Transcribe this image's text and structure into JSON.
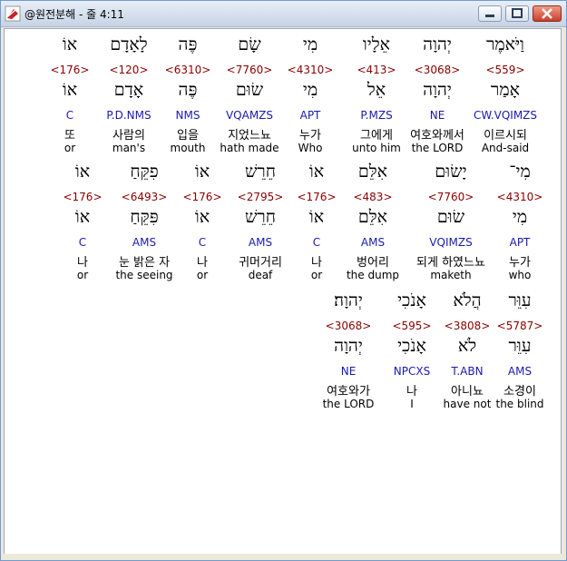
{
  "window": {
    "title": "@원전분해 - 줄 4:11"
  },
  "colors": {
    "strong": "#8b0000",
    "parse": "#1a1ab0",
    "text": "#000000"
  },
  "rows": [
    [
      {
        "heb": "וַיֹּאמֶר",
        "num": "<559>",
        "lemma": "אָמַר",
        "parse": "CW.VQIMZS",
        "kor": "이르시되",
        "eng": "And-said"
      },
      {
        "heb": "יְהוָה",
        "num": "<3068>",
        "lemma": "יְהוָה",
        "parse": "NE",
        "kor": "여호와께서",
        "eng": "the LORD"
      },
      {
        "heb": "אֵלָיו",
        "num": "<413>",
        "lemma": "אֵל",
        "parse": "P.MZS",
        "kor": "그에게",
        "eng": "unto him"
      },
      {
        "heb": "מִי",
        "num": "<4310>",
        "lemma": "מִי",
        "parse": "APT",
        "kor": "누가",
        "eng": "Who"
      },
      {
        "heb": "שָׂם",
        "num": "<7760>",
        "lemma": "שׂוּם",
        "parse": "VQAMZS",
        "kor": "지었느뇨",
        "eng": "hath made"
      },
      {
        "heb": "פֶּה",
        "num": "<6310>",
        "lemma": "פֶּה",
        "parse": "NMS",
        "kor": "입을",
        "eng": "mouth"
      },
      {
        "heb": "לָאָדָם",
        "num": "<120>",
        "lemma": "אָדָם",
        "parse": "P.D.NMS",
        "kor": "사람의",
        "eng": "man's"
      },
      {
        "heb": "אוֹ",
        "num": "<176>",
        "lemma": "אוֹ",
        "parse": "C",
        "kor": "또",
        "eng": "or"
      }
    ],
    [
      {
        "heb": "מִי־",
        "num": "<4310>",
        "lemma": "מִי",
        "parse": "APT",
        "kor": "누가",
        "eng": "who"
      },
      {
        "heb": "יָשׂוּם",
        "num": "<7760>",
        "lemma": "שׂוּם",
        "parse": "VQIMZS",
        "kor": "되게 하였느뇨",
        "eng": "maketh"
      },
      {
        "heb": "אִלֵּם",
        "num": "<483>",
        "lemma": "אִלֵּם",
        "parse": "AMS",
        "kor": "벙어리",
        "eng": "the dump"
      },
      {
        "heb": "אוֹ",
        "num": "<176>",
        "lemma": "אוֹ",
        "parse": "C",
        "kor": "나",
        "eng": "or"
      },
      {
        "heb": "חֵרֵשׁ",
        "num": "<2795>",
        "lemma": "חֵרֵשׁ",
        "parse": "AMS",
        "kor": "귀머거리",
        "eng": "deaf"
      },
      {
        "heb": "אוֹ",
        "num": "<176>",
        "lemma": "אוֹ",
        "parse": "C",
        "kor": "나",
        "eng": "or"
      },
      {
        "heb": "פִקֵּחַ",
        "num": "<6493>",
        "lemma": "פִּקֵּחַ",
        "parse": "AMS",
        "kor": "눈 밝은 자",
        "eng": "the seeing"
      },
      {
        "heb": "אוֹ",
        "num": "<176>",
        "lemma": "אוֹ",
        "parse": "C",
        "kor": "나",
        "eng": "or"
      }
    ],
    [
      {
        "heb": "עִוֵּר",
        "num": "<5787>",
        "lemma": "עִוֵּר",
        "parse": "AMS",
        "kor": "소경이",
        "eng": "the blind"
      },
      {
        "heb": "הֲלֹא",
        "num": "<3808>",
        "lemma": "לֹא",
        "parse": "T.ABN",
        "kor": "아니뇨",
        "eng": "have not"
      },
      {
        "heb": "אָנֹכִי",
        "num": "<595>",
        "lemma": "אָנֹכִי",
        "parse": "NPCXS",
        "kor": "나",
        "eng": "I"
      },
      {
        "heb": "יְהוָה׃",
        "num": "<3068>",
        "lemma": "יְהוָה",
        "parse": "NE",
        "kor": "여호와가",
        "eng": "the LORD"
      }
    ]
  ]
}
